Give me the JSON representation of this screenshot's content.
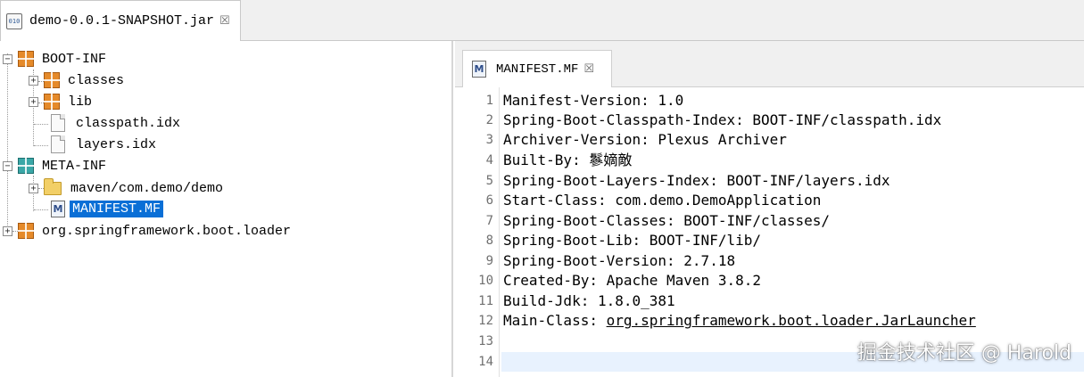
{
  "top_tab": {
    "label": "demo-0.0.1-SNAPSHOT.jar",
    "close": "☒",
    "icon": "010"
  },
  "tree": {
    "boot_inf": "BOOT-INF",
    "classes": "classes",
    "lib": "lib",
    "classpath_idx": "classpath.idx",
    "layers_idx": "layers.idx",
    "meta_inf": "META-INF",
    "maven": "maven/com.demo/demo",
    "manifest": "MANIFEST.MF",
    "loader": "org.springframework.boot.loader",
    "expand": "+",
    "collapse": "−"
  },
  "editor_tab": {
    "label": "MANIFEST.MF",
    "close": "☒",
    "icon": "M"
  },
  "code": {
    "lines": [
      {
        "n": "1",
        "text": "Manifest-Version: 1.0"
      },
      {
        "n": "2",
        "text": "Spring-Boot-Classpath-Index: BOOT-INF/classpath.idx"
      },
      {
        "n": "3",
        "text": "Archiver-Version: Plexus Archiver"
      },
      {
        "n": "4",
        "text": "Built-By: 鬖嫡敵"
      },
      {
        "n": "5",
        "text": "Spring-Boot-Layers-Index: BOOT-INF/layers.idx"
      },
      {
        "n": "6",
        "text": "Start-Class: com.demo.DemoApplication"
      },
      {
        "n": "7",
        "text": "Spring-Boot-Classes: BOOT-INF/classes/"
      },
      {
        "n": "8",
        "text": "Spring-Boot-Lib: BOOT-INF/lib/"
      },
      {
        "n": "9",
        "text": "Spring-Boot-Version: 2.7.18"
      },
      {
        "n": "10",
        "text": "Created-By: Apache Maven 3.8.2"
      },
      {
        "n": "11",
        "text": "Build-Jdk: 1.8.0_381"
      },
      {
        "n": "12",
        "text": "Main-Class: ",
        "link": "org.springframework.boot.loader.JarLauncher"
      },
      {
        "n": "13",
        "text": ""
      },
      {
        "n": "14",
        "text": ""
      }
    ]
  },
  "watermark": "掘金技术社区 @ Harold",
  "colors": {
    "selection": "#0a6fd6",
    "active_line": "#e8f2fe",
    "package_orange": "#e58a2a",
    "package_teal": "#3aa7a7"
  }
}
